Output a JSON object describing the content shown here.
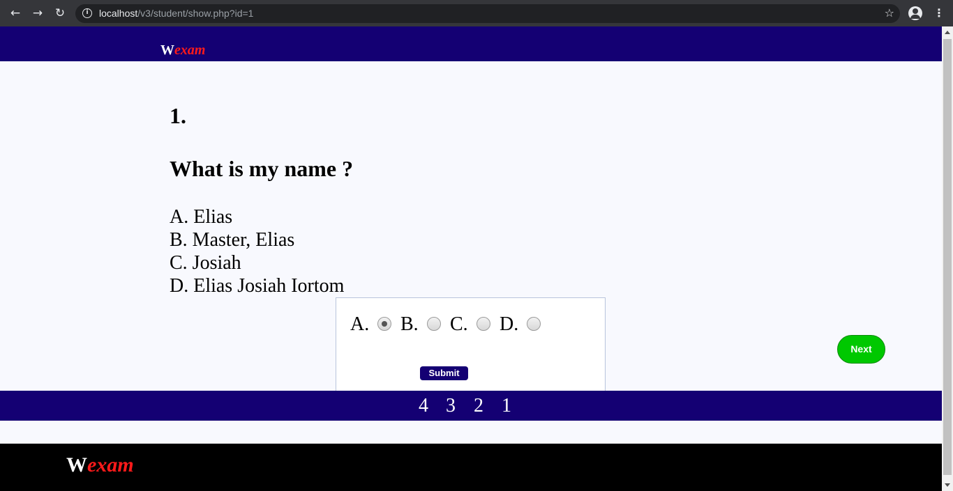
{
  "browser": {
    "url_host": "localhost",
    "url_path": "/v3/student/show.php?id=1"
  },
  "brand": {
    "first": "W",
    "rest": "exam"
  },
  "question": {
    "number": "1.",
    "text": "What is my name ?",
    "options": [
      "A. Elias",
      "B. Master, Elias",
      "C. Josiah",
      "D. Elias Josiah Iortom"
    ]
  },
  "answer_form": {
    "choices": [
      "A.",
      "B.",
      "C.",
      "D."
    ],
    "selected": "A.",
    "submit_label": "Submit"
  },
  "next_label": "Next",
  "pagination": [
    "4",
    "3",
    "2",
    "1"
  ],
  "footer_brand": {
    "first": "W",
    "rest": "exam"
  }
}
